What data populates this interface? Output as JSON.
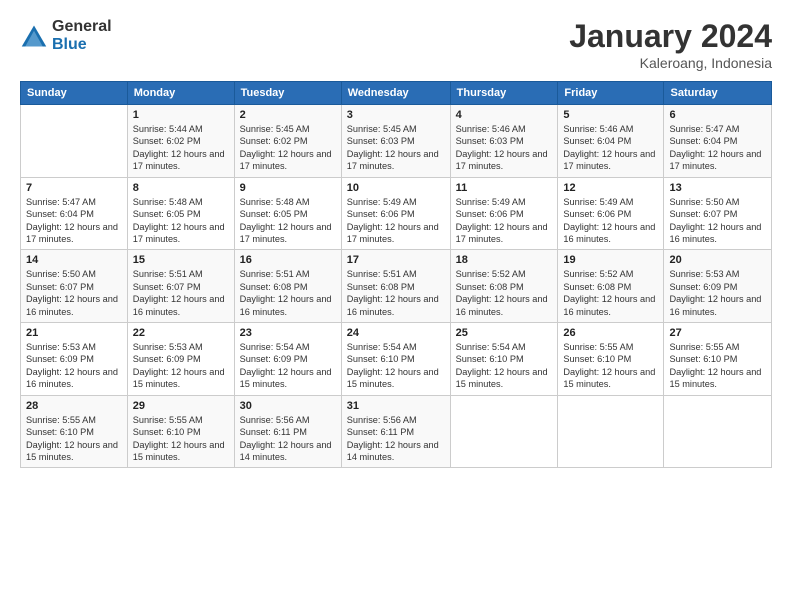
{
  "header": {
    "logo_general": "General",
    "logo_blue": "Blue",
    "month_year": "January 2024",
    "location": "Kaleroang, Indonesia"
  },
  "weekdays": [
    "Sunday",
    "Monday",
    "Tuesday",
    "Wednesday",
    "Thursday",
    "Friday",
    "Saturday"
  ],
  "weeks": [
    [
      {
        "day": "",
        "info": ""
      },
      {
        "day": "1",
        "info": "Sunrise: 5:44 AM\nSunset: 6:02 PM\nDaylight: 12 hours\nand 17 minutes."
      },
      {
        "day": "2",
        "info": "Sunrise: 5:45 AM\nSunset: 6:02 PM\nDaylight: 12 hours\nand 17 minutes."
      },
      {
        "day": "3",
        "info": "Sunrise: 5:45 AM\nSunset: 6:03 PM\nDaylight: 12 hours\nand 17 minutes."
      },
      {
        "day": "4",
        "info": "Sunrise: 5:46 AM\nSunset: 6:03 PM\nDaylight: 12 hours\nand 17 minutes."
      },
      {
        "day": "5",
        "info": "Sunrise: 5:46 AM\nSunset: 6:04 PM\nDaylight: 12 hours\nand 17 minutes."
      },
      {
        "day": "6",
        "info": "Sunrise: 5:47 AM\nSunset: 6:04 PM\nDaylight: 12 hours\nand 17 minutes."
      }
    ],
    [
      {
        "day": "7",
        "info": "Sunrise: 5:47 AM\nSunset: 6:04 PM\nDaylight: 12 hours\nand 17 minutes."
      },
      {
        "day": "8",
        "info": "Sunrise: 5:48 AM\nSunset: 6:05 PM\nDaylight: 12 hours\nand 17 minutes."
      },
      {
        "day": "9",
        "info": "Sunrise: 5:48 AM\nSunset: 6:05 PM\nDaylight: 12 hours\nand 17 minutes."
      },
      {
        "day": "10",
        "info": "Sunrise: 5:49 AM\nSunset: 6:06 PM\nDaylight: 12 hours\nand 17 minutes."
      },
      {
        "day": "11",
        "info": "Sunrise: 5:49 AM\nSunset: 6:06 PM\nDaylight: 12 hours\nand 17 minutes."
      },
      {
        "day": "12",
        "info": "Sunrise: 5:49 AM\nSunset: 6:06 PM\nDaylight: 12 hours\nand 16 minutes."
      },
      {
        "day": "13",
        "info": "Sunrise: 5:50 AM\nSunset: 6:07 PM\nDaylight: 12 hours\nand 16 minutes."
      }
    ],
    [
      {
        "day": "14",
        "info": "Sunrise: 5:50 AM\nSunset: 6:07 PM\nDaylight: 12 hours\nand 16 minutes."
      },
      {
        "day": "15",
        "info": "Sunrise: 5:51 AM\nSunset: 6:07 PM\nDaylight: 12 hours\nand 16 minutes."
      },
      {
        "day": "16",
        "info": "Sunrise: 5:51 AM\nSunset: 6:08 PM\nDaylight: 12 hours\nand 16 minutes."
      },
      {
        "day": "17",
        "info": "Sunrise: 5:51 AM\nSunset: 6:08 PM\nDaylight: 12 hours\nand 16 minutes."
      },
      {
        "day": "18",
        "info": "Sunrise: 5:52 AM\nSunset: 6:08 PM\nDaylight: 12 hours\nand 16 minutes."
      },
      {
        "day": "19",
        "info": "Sunrise: 5:52 AM\nSunset: 6:08 PM\nDaylight: 12 hours\nand 16 minutes."
      },
      {
        "day": "20",
        "info": "Sunrise: 5:53 AM\nSunset: 6:09 PM\nDaylight: 12 hours\nand 16 minutes."
      }
    ],
    [
      {
        "day": "21",
        "info": "Sunrise: 5:53 AM\nSunset: 6:09 PM\nDaylight: 12 hours\nand 16 minutes."
      },
      {
        "day": "22",
        "info": "Sunrise: 5:53 AM\nSunset: 6:09 PM\nDaylight: 12 hours\nand 15 minutes."
      },
      {
        "day": "23",
        "info": "Sunrise: 5:54 AM\nSunset: 6:09 PM\nDaylight: 12 hours\nand 15 minutes."
      },
      {
        "day": "24",
        "info": "Sunrise: 5:54 AM\nSunset: 6:10 PM\nDaylight: 12 hours\nand 15 minutes."
      },
      {
        "day": "25",
        "info": "Sunrise: 5:54 AM\nSunset: 6:10 PM\nDaylight: 12 hours\nand 15 minutes."
      },
      {
        "day": "26",
        "info": "Sunrise: 5:55 AM\nSunset: 6:10 PM\nDaylight: 12 hours\nand 15 minutes."
      },
      {
        "day": "27",
        "info": "Sunrise: 5:55 AM\nSunset: 6:10 PM\nDaylight: 12 hours\nand 15 minutes."
      }
    ],
    [
      {
        "day": "28",
        "info": "Sunrise: 5:55 AM\nSunset: 6:10 PM\nDaylight: 12 hours\nand 15 minutes."
      },
      {
        "day": "29",
        "info": "Sunrise: 5:55 AM\nSunset: 6:10 PM\nDaylight: 12 hours\nand 15 minutes."
      },
      {
        "day": "30",
        "info": "Sunrise: 5:56 AM\nSunset: 6:11 PM\nDaylight: 12 hours\nand 14 minutes."
      },
      {
        "day": "31",
        "info": "Sunrise: 5:56 AM\nSunset: 6:11 PM\nDaylight: 12 hours\nand 14 minutes."
      },
      {
        "day": "",
        "info": ""
      },
      {
        "day": "",
        "info": ""
      },
      {
        "day": "",
        "info": ""
      }
    ]
  ]
}
